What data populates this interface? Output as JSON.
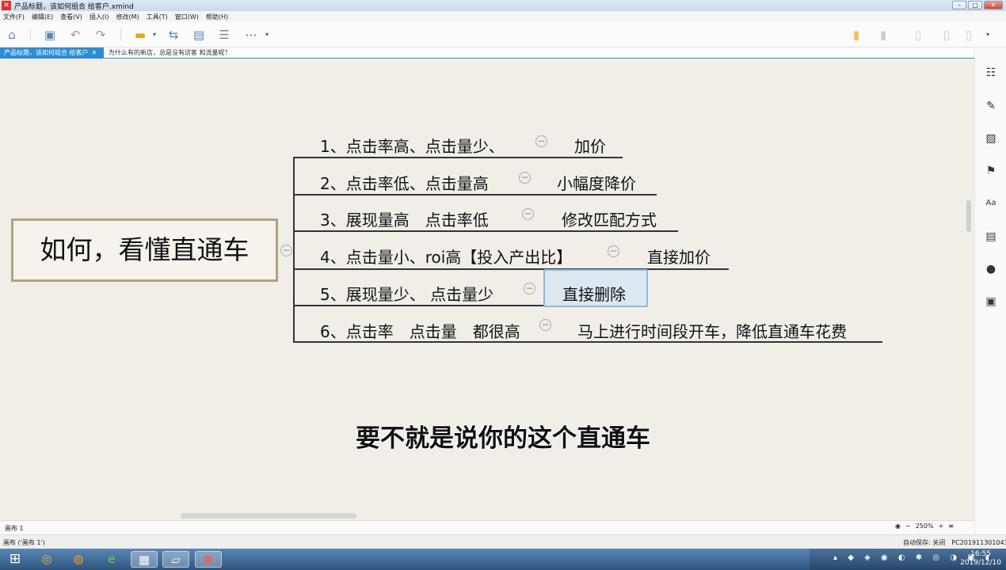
{
  "window": {
    "title": "产品标题，该如何组合 给客户.xmind"
  },
  "menu": [
    "文件(F)",
    "编辑(E)",
    "查看(V)",
    "插入(I)",
    "修改(M)",
    "工具(T)",
    "窗口(W)",
    "帮助(H)"
  ],
  "tabs": {
    "active": "产品标题，该如何组合 给客户",
    "inactive": "为什么有的新店，总是没有访客 和流量呢？"
  },
  "mindmap": {
    "central": "如何，看懂直通车",
    "branches": [
      {
        "text": "1、点击率高、点击量少、",
        "action": "加价"
      },
      {
        "text": "2、点击率低、点击量高",
        "action": "小幅度降价"
      },
      {
        "text": "3、展现量高　点击率低",
        "action": "修改匹配方式"
      },
      {
        "text": "4、点击量小、roi高【投入产出比】",
        "action": "直接加价"
      },
      {
        "text": "5、展现量少、 点击量少",
        "action": "直接删除"
      },
      {
        "text": "6、点击率　点击量　都很高",
        "action": "马上进行时间段开车，降低直通车花费"
      }
    ],
    "collapse_glyph": "−"
  },
  "subtitle": "要不就是说你的这个直通车",
  "sheet": {
    "label": "画布 1",
    "zoom": "250%"
  },
  "status": {
    "left": "画布 ('画布 1')",
    "autosave": "自动保存: 关闭",
    "pc": "PC201911301043"
  },
  "clock": {
    "time": "16:55",
    "date": "2019/12/10"
  }
}
